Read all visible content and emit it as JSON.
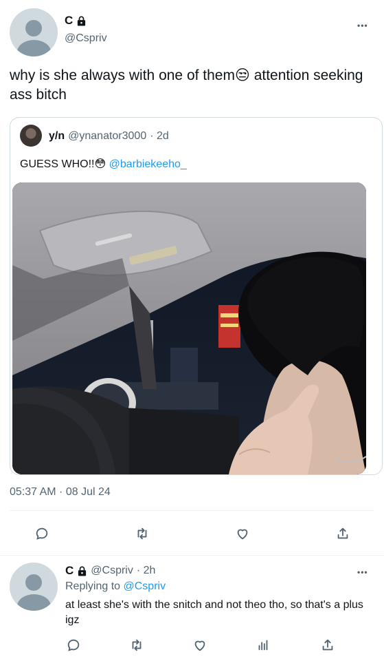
{
  "main_tweet": {
    "display_name": "C",
    "handle": "@Cspriv",
    "text": "why is she always with one of them😒  attention seeking ass bitch",
    "timestamp": "05:37 AM · 08 Jul 24",
    "more_label": "•••"
  },
  "quote_tweet": {
    "display_name": "y/n",
    "handle": "@ynanator3000",
    "time": "· 2d",
    "text": "GUESS WHO!!😳 ",
    "mention": "@barbiekeeho_"
  },
  "reply": {
    "display_name": "C",
    "handle": "@Cspriv",
    "time": "· 2h",
    "replying_prefix": "Replying to ",
    "replying_to": "@Cspriv",
    "text": "at least she's with the snitch and not theo tho, so that's a plus igz",
    "more_label": "•••"
  },
  "icons": {
    "lock": "lock-icon",
    "reply": "reply-icon",
    "retweet": "retweet-icon",
    "like": "heart-icon",
    "share": "share-icon",
    "views": "views-icon"
  },
  "colors": {
    "link": "#1d9bf0",
    "secondary": "#536471",
    "border": "#cfd9de"
  }
}
